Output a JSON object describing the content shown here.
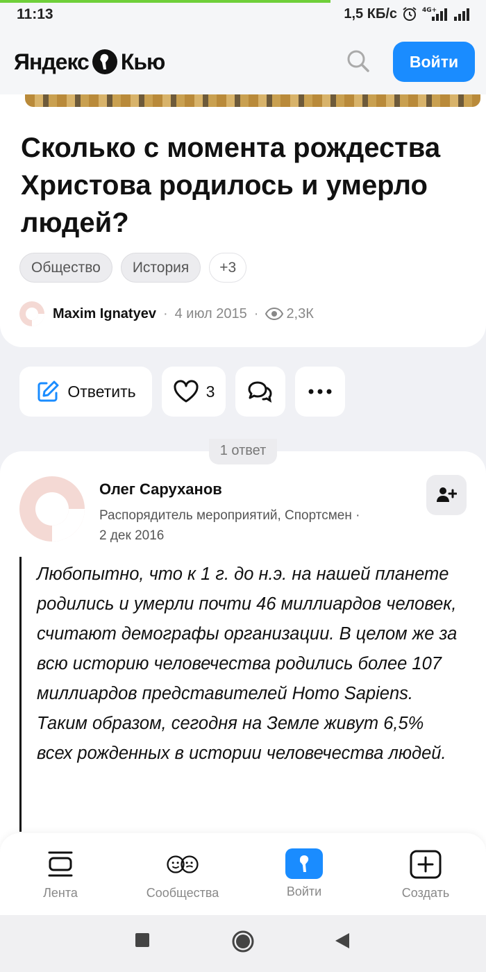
{
  "status_bar": {
    "time": "11:13",
    "speed": "1,5 КБ/с",
    "network": "4G+"
  },
  "header": {
    "logo_left": "Яндекс",
    "logo_right": "Кью",
    "login_label": "Войти"
  },
  "question": {
    "title": "Сколько с момента рождества Христова родилось и умерло людей?",
    "tags": [
      "Общество",
      "История"
    ],
    "more_tags": "+3",
    "author": "Maxim Ignatyev",
    "date": "4 июл 2015",
    "views": "2,3К"
  },
  "actions": {
    "reply_label": "Ответить",
    "likes": "3"
  },
  "answers": {
    "count_label": "1 ответ",
    "items": [
      {
        "author": "Олег Саруханов",
        "role": "Распорядитель мероприятий, Спортсмен",
        "date": "2 дек 2016",
        "text": "Любопытно, что к 1 г. до н.э. на нашей планете родились и умерли почти 46 миллиардов человек, считают демографы организации. В целом же за всю историю человечества родились более 107 миллиардов представителей Homo Sapiens. Таким образом, сегодня на Земле живут 6,5% всех рожденных в истории человечества людей."
      }
    ]
  },
  "bottom_nav": {
    "items": [
      "Лента",
      "Сообщества",
      "Войти",
      "Создать"
    ]
  },
  "colors": {
    "accent": "#1a8cff",
    "progress": "#6fcf3a",
    "background": "#f0f1f5"
  }
}
